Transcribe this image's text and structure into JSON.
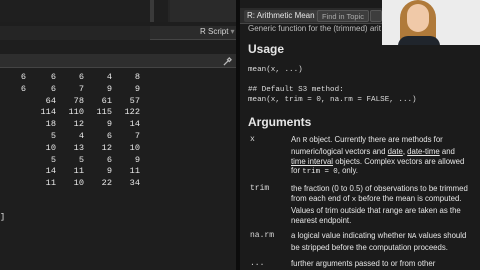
{
  "console": {
    "script_tab": "R Script",
    "rows": [
      [
        "6",
        "6",
        "6",
        "4",
        "8"
      ],
      [
        "6",
        "6",
        "7",
        "9",
        "9"
      ],
      [
        "64",
        "78",
        "61",
        "57",
        ""
      ],
      [
        "114",
        "110",
        "115",
        "122",
        ""
      ],
      [
        "18",
        "12",
        "9",
        "14",
        ""
      ],
      [
        "5",
        "4",
        "6",
        "7",
        ""
      ],
      [
        "10",
        "13",
        "12",
        "10",
        ""
      ],
      [
        "5",
        "5",
        "6",
        "9",
        ""
      ],
      [
        "14",
        "11",
        "9",
        "11",
        ""
      ],
      [
        "11",
        "10",
        "22",
        "34",
        ""
      ]
    ],
    "closing": "]"
  },
  "help": {
    "tab_label": "R: Arithmetic Mean ▾",
    "find_placeholder": "Find in Topic",
    "top_line": "Generic function for the (trimmed) arit",
    "usage_heading": "Usage",
    "usage_code": "mean(x, ...)",
    "default_comment": "## Default S3 method:",
    "default_code": "mean(x, trim = 0, na.rm = FALSE, ...)",
    "arguments_heading": "Arguments",
    "arguments": [
      {
        "name": "x",
        "desc_1": "An ",
        "desc_r": "R",
        "desc_2": " object. Currently there are methods for numeric/logical vectors and ",
        "link_date": "date",
        "desc_3": ", ",
        "link_datetime": "date-time",
        "desc_4": " and ",
        "link_interval": "time interval",
        "desc_5": " objects. Complex vectors are allowed for ",
        "code": "trim = 0",
        "desc_6": ", only."
      },
      {
        "name": "trim",
        "desc_1": "the fraction (0 to 0.5) of observations to be trimmed from each end of ",
        "code": "x",
        "desc_2": " before the mean is computed. Values of trim outside that range are taken as the nearest endpoint."
      },
      {
        "name": "na.rm",
        "desc_1": "a logical value indicating whether ",
        "code": "NA",
        "desc_2": " values should be stripped before the computation proceeds."
      },
      {
        "name": "...",
        "desc_1": "further arguments passed to or from other methods."
      }
    ]
  }
}
